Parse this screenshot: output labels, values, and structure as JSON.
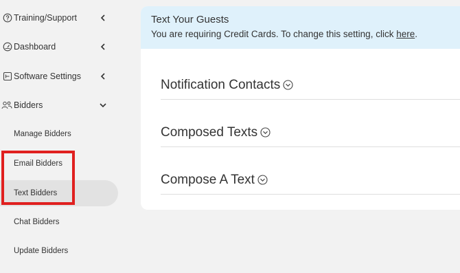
{
  "sidebar": {
    "items": [
      {
        "label": "Training/Support",
        "icon": "question-circle-icon"
      },
      {
        "label": "Dashboard",
        "icon": "dashboard-gauge-icon"
      },
      {
        "label": "Software Settings",
        "icon": "settings-table-icon"
      },
      {
        "label": "Bidders",
        "icon": "users-icon"
      }
    ],
    "sub_items": [
      {
        "label": "Manage Bidders"
      },
      {
        "label": "Email Bidders"
      },
      {
        "label": "Text Bidders"
      },
      {
        "label": "Chat Bidders"
      },
      {
        "label": "Update Bidders"
      }
    ]
  },
  "banner": {
    "title": "Text Your Guests",
    "message": "You are requiring Credit Cards. To change this setting, click ",
    "link": "here",
    "suffix": "."
  },
  "sections": [
    {
      "title": "Notification Contacts"
    },
    {
      "title": "Composed Texts"
    },
    {
      "title": "Compose A Text"
    }
  ],
  "colors": {
    "highlight": "#e0201f",
    "banner_bg": "#dff1fb",
    "active_bg": "#e2e2e2"
  }
}
